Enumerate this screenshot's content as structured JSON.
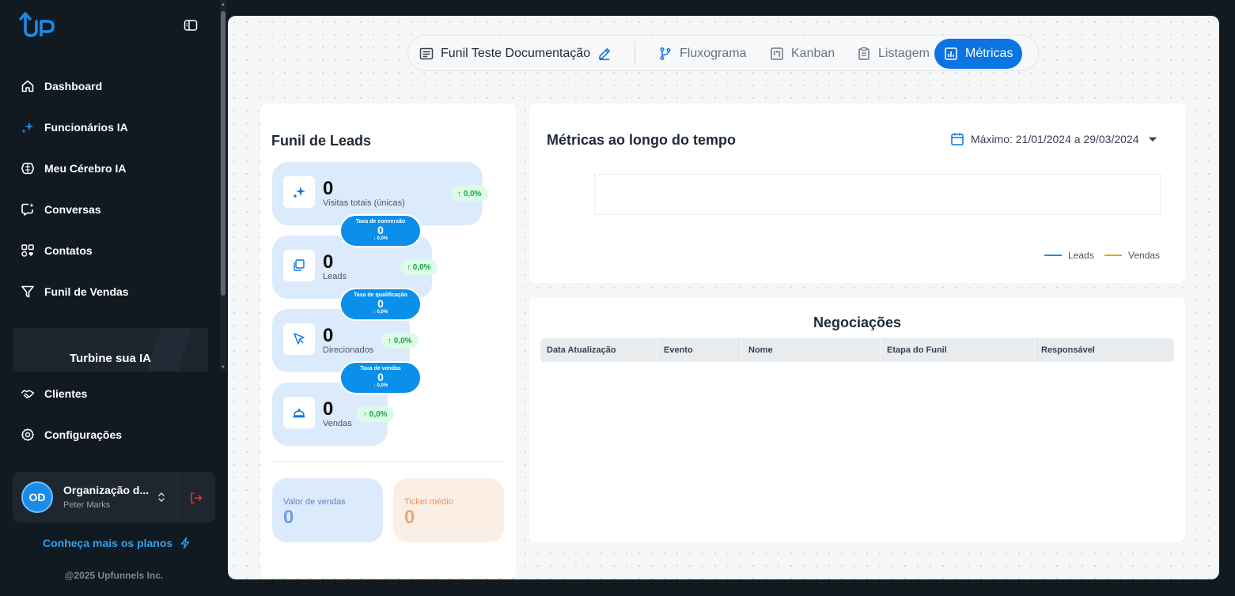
{
  "app": {
    "logo_text": "UP"
  },
  "sidebar": {
    "items": [
      {
        "label": "Dashboard",
        "icon": "home-icon"
      },
      {
        "label": "Funcionários IA",
        "icon": "sparkles-icon"
      },
      {
        "label": "Meu Cérebro IA",
        "icon": "brain-icon"
      },
      {
        "label": "Conversas",
        "icon": "chat-icon"
      },
      {
        "label": "Contatos",
        "icon": "contacts-icon"
      },
      {
        "label": "Funil de Vendas",
        "icon": "filter-icon"
      },
      {
        "label": "Clientes",
        "icon": "handshake-icon"
      },
      {
        "label": "Configurações",
        "icon": "gear-icon"
      }
    ],
    "promo": "Turbine sua IA",
    "org": {
      "initials": "OD",
      "name": "Organização d...",
      "user": "Peter Marks"
    },
    "plans_link": "Conheça mais os planos",
    "copyright": "@2025 Upfunnels Inc."
  },
  "tabs": {
    "funnel_name": "Funil Teste Documentação",
    "items": [
      "Fluxograma",
      "Kanban",
      "Listagem",
      "Métricas"
    ],
    "active": "Métricas"
  },
  "funnel": {
    "title": "Funil de Leads",
    "stages": [
      {
        "value": "0",
        "label": "Visitas totais (únicas)",
        "growth": "↑ 0,0%",
        "icon": "sparkles-icon"
      },
      {
        "value": "0",
        "label": "Leads",
        "growth": "↑ 0,0%",
        "icon": "cards-icon"
      },
      {
        "value": "0",
        "label": "Direcionados",
        "growth": "↑ 0,0%",
        "icon": "cursor-icon"
      },
      {
        "value": "0",
        "label": "Vendas",
        "growth": "↑ 0,0%",
        "icon": "bell-icon"
      }
    ],
    "rates": [
      {
        "title": "Taxa de conversão",
        "value": "0",
        "delta": "↓ 0,0%"
      },
      {
        "title": "Taxa de qualificação",
        "value": "0",
        "delta": "↓ 0,0%"
      },
      {
        "title": "Taxa de vendas",
        "value": "0",
        "delta": "↓ 0,0%"
      }
    ],
    "sales_value": {
      "title": "Valor de vendas",
      "value": "0"
    },
    "ticket": {
      "title": "Ticket médio",
      "value": "0"
    }
  },
  "metrics": {
    "title": "Métricas ao longo do tempo",
    "date_range": "Máximo: 21/01/2024 a 29/03/2024",
    "legend": [
      {
        "name": "Leads",
        "color": "#1a8ce8"
      },
      {
        "name": "Vendas",
        "color": "#f59e0b"
      }
    ]
  },
  "negotiations": {
    "title": "Negociações",
    "columns": [
      "Data Atualização",
      "Evento",
      "Nome",
      "Etapa do Funil",
      "Responsável"
    ]
  }
}
